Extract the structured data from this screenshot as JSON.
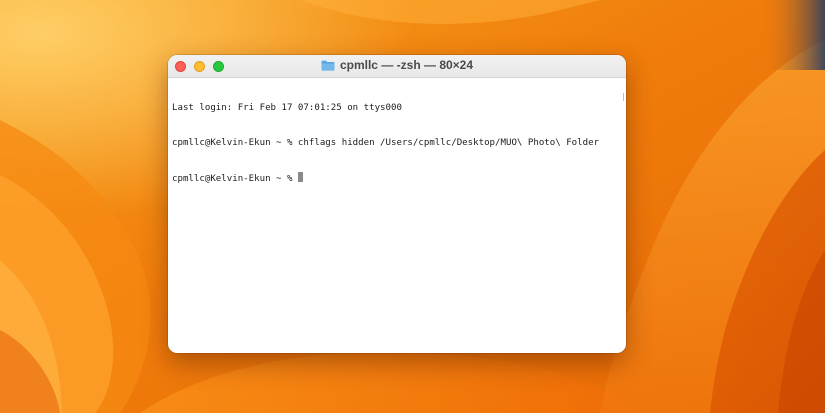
{
  "desktop": {
    "wallpaper": "macOS Ventura orange wallpaper",
    "colors": {
      "base": "#f0820a",
      "light": "#ffab33",
      "deep": "#d95400",
      "highlight": "#ffd27a",
      "edge_dark": "#1f3a66"
    }
  },
  "window": {
    "title": "cpmllc — -zsh — 80×24",
    "title_icon": "folder-icon",
    "controls": {
      "close": "close-icon",
      "minimize": "minimize-icon",
      "zoom": "zoom-icon"
    },
    "colors": {
      "close": "#fe5f57",
      "minimize": "#febc2e",
      "zoom": "#28c840",
      "folder": "#5aa6e0"
    }
  },
  "terminal": {
    "lines": [
      "Last login: Fri Feb 17 07:01:25 on ttys000",
      "cpmllc@Kelvin-Ekun ~ % chflags hidden /Users/cpmllc/Desktop/MUO\\ Photo\\ Folder",
      "cpmllc@Kelvin-Ekun ~ % "
    ]
  }
}
